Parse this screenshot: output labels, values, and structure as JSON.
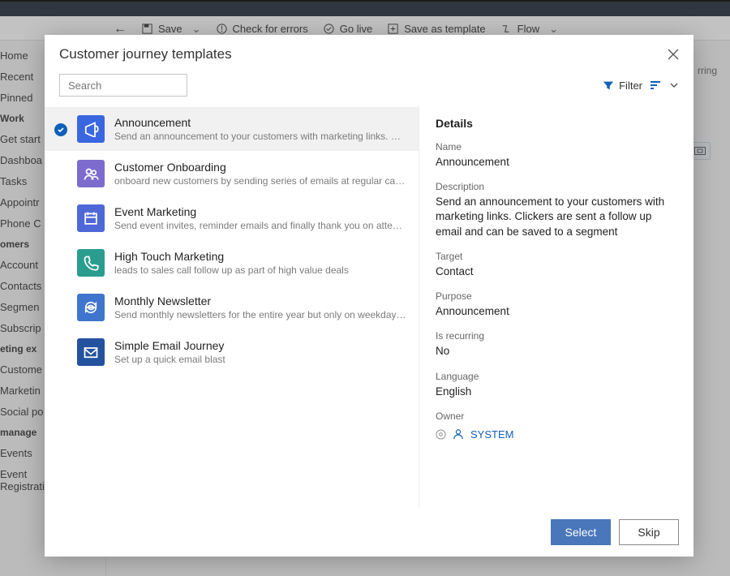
{
  "bg": {
    "cmdbar": {
      "back": "←",
      "save": "Save",
      "check": "Check for errors",
      "golive": "Go live",
      "saveas": "Save as template",
      "flow": "Flow"
    },
    "right_label": "rring",
    "sidebar": {
      "s1": [
        "Home",
        "Recent",
        "Pinned"
      ],
      "g1": "Work",
      "s2": [
        "Get start",
        "Dashboa",
        "Tasks",
        "Appointr",
        "Phone C"
      ],
      "g2": "omers",
      "s3": [
        "Account",
        "Contacts",
        "Segmen",
        "Subscrip"
      ],
      "g3": "eting ex",
      "s4": [
        "Custome",
        "Marketin",
        "Social po"
      ],
      "g4": " manage",
      "s5": [
        "Events",
        "Event Registrations"
      ]
    }
  },
  "modal": {
    "title": "Customer journey templates",
    "search_placeholder": "Search",
    "filter_label": "Filter",
    "templates": [
      {
        "name": "Announcement",
        "desc": "Send an announcement to your customers with marketing links. Clickers are sent a…",
        "icon": "megaphone",
        "color": "c-blue",
        "selected": true
      },
      {
        "name": "Customer Onboarding",
        "desc": "onboard new customers by sending series of emails at regular cadence",
        "icon": "people",
        "color": "c-purp"
      },
      {
        "name": "Event Marketing",
        "desc": "Send event invites, reminder emails and finally thank you on attending",
        "icon": "calendar",
        "color": "c-blue2"
      },
      {
        "name": "High Touch Marketing",
        "desc": "leads to sales call follow up as part of high value deals",
        "icon": "phone",
        "color": "c-teal"
      },
      {
        "name": "Monthly Newsletter",
        "desc": "Send monthly newsletters for the entire year but only on weekday afternoons",
        "icon": "cycle",
        "color": "c-mid"
      },
      {
        "name": "Simple Email Journey",
        "desc": "Set up a quick email blast",
        "icon": "mail",
        "color": "c-navy"
      }
    ],
    "details": {
      "heading": "Details",
      "labels": {
        "name": "Name",
        "desc": "Description",
        "target": "Target",
        "purpose": "Purpose",
        "recurring": "Is recurring",
        "lang": "Language",
        "owner": "Owner"
      },
      "values": {
        "name": "Announcement",
        "desc": "Send an announcement to your customers with marketing links. Clickers are sent a follow up email and can be saved to a segment",
        "target": "Contact",
        "purpose": "Announcement",
        "recurring": "No",
        "lang": "English",
        "owner": "SYSTEM"
      }
    },
    "buttons": {
      "select": "Select",
      "skip": "Skip"
    }
  }
}
